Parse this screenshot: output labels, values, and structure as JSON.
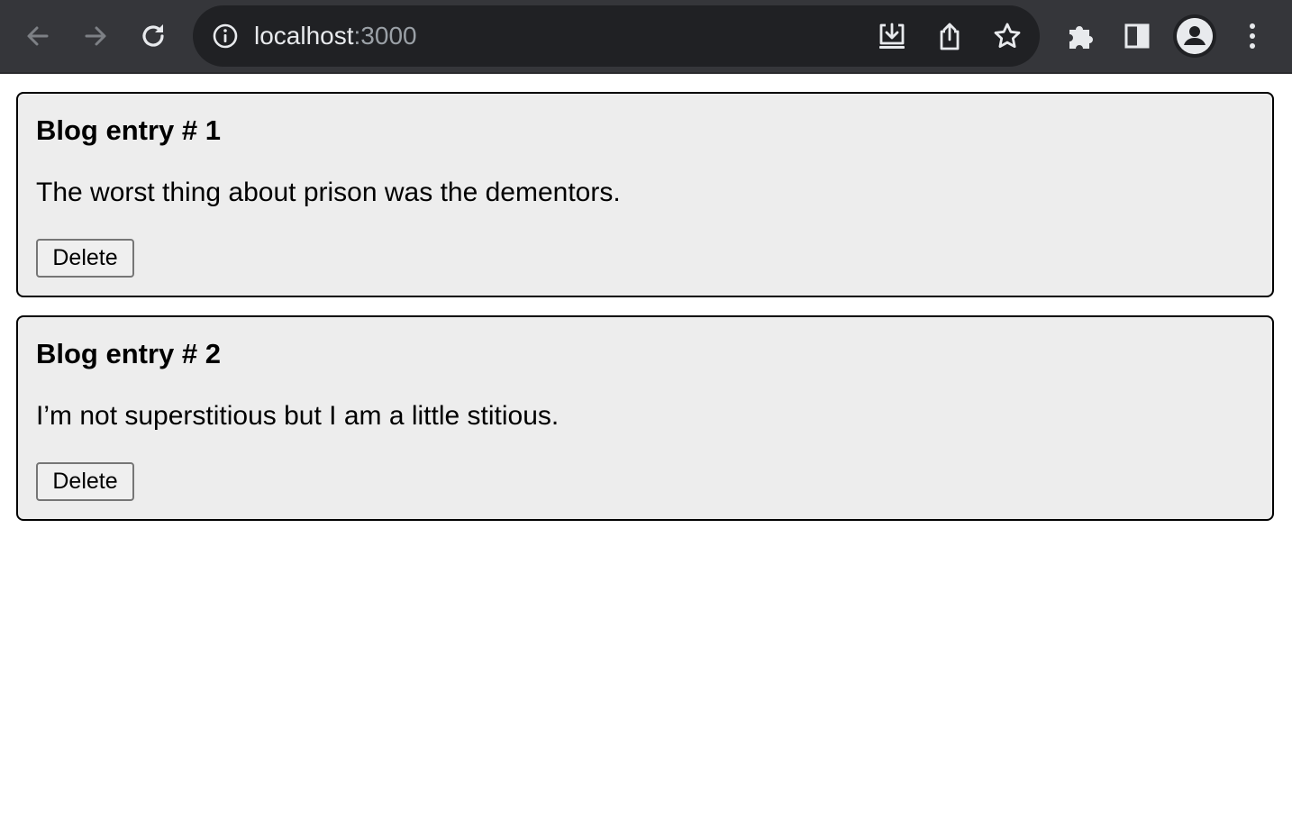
{
  "browser": {
    "url_host": "localhost",
    "url_port": ":3000",
    "icons": {
      "back": "arrow-left",
      "forward": "arrow-right",
      "reload": "reload",
      "site_info": "info-circle",
      "install": "install-app",
      "share": "share",
      "bookmark": "star",
      "extensions": "puzzle",
      "side_panel": "side-panel",
      "profile": "person",
      "menu": "kebab-vertical"
    },
    "colors": {
      "toolbar": "#35363a",
      "omnibox": "#202124",
      "icon": "#e8eaed",
      "icon_disabled": "#7d8085"
    }
  },
  "entries": [
    {
      "title": "Blog entry # 1",
      "body": "The worst thing about prison was the dementors.",
      "delete_label": "Delete"
    },
    {
      "title": "Blog entry # 2",
      "body": "I’m not superstitious but I am a little stitious.",
      "delete_label": "Delete"
    }
  ],
  "colors": {
    "card_background": "#ededed",
    "card_border": "#000000",
    "button_background": "#efefef",
    "button_border": "#767676"
  }
}
